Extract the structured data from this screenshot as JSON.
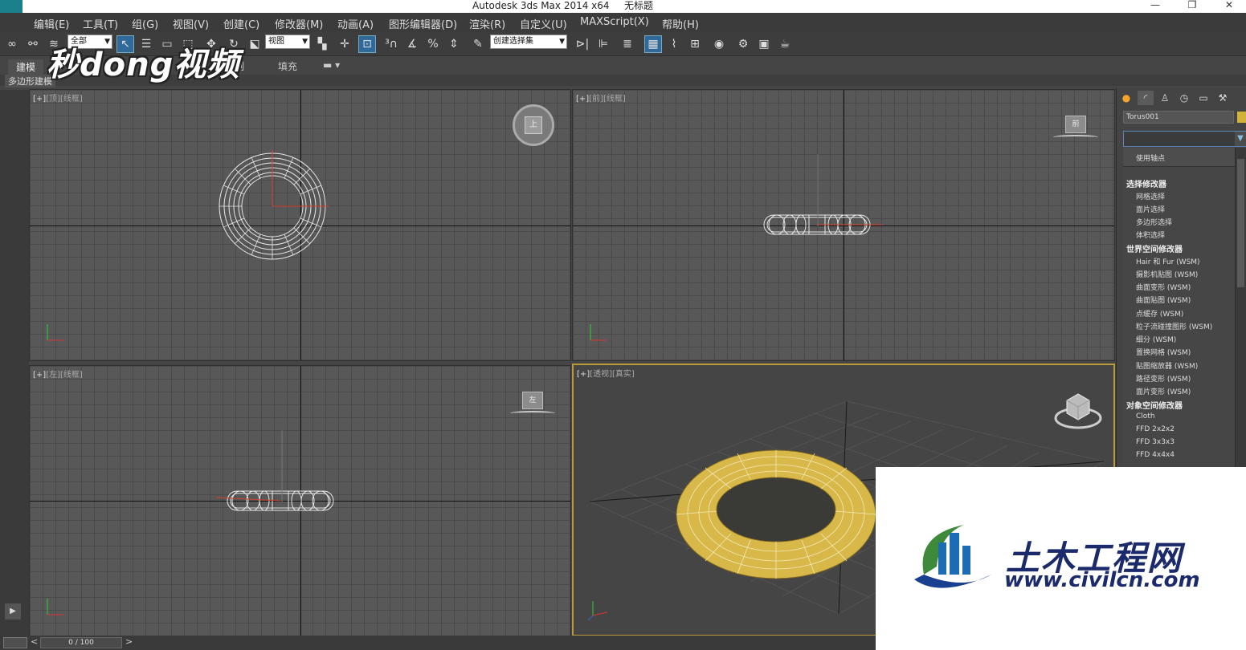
{
  "window": {
    "title": "Autodesk 3ds Max  2014 x64",
    "document": "无标题",
    "controls": [
      "—",
      "❐",
      "✕"
    ]
  },
  "menu": [
    "编辑(E)",
    "工具(T)",
    "组(G)",
    "视图(V)",
    "创建(C)",
    "修改器(M)",
    "动画(A)",
    "图形编辑器(D)",
    "渲染(R)",
    "自定义(U)",
    "MAXScript(X)",
    "帮助(H)"
  ],
  "toolbar": {
    "filter_value": "全部",
    "refcoord_value": "视图",
    "named_selection_value": "创建选择集"
  },
  "ribbon": {
    "tabs": [
      "建模",
      "绘制",
      "填充"
    ],
    "sub_label": "多边形建模"
  },
  "viewports": {
    "top": {
      "label_a": "[+]",
      "label_b": "[顶]",
      "label_c": "[线框]",
      "cube": "上"
    },
    "front": {
      "label_a": "[+]",
      "label_b": "[前]",
      "label_c": "[线框]",
      "cube": "前"
    },
    "left": {
      "label_a": "[+]",
      "label_b": "[左]",
      "label_c": "[线框]",
      "cube": "左"
    },
    "perspective": {
      "label_a": "[+]",
      "label_b": "[透视]",
      "label_c": "[真实]"
    }
  },
  "command_panel": {
    "object_name": "Torus001",
    "object_color": "#d2b33a",
    "modifier_dropdown": {
      "first_item": "使用轴点",
      "groups": [
        {
          "header": "选择修改器",
          "items": [
            "网格选择",
            "面片选择",
            "多边形选择",
            "体积选择"
          ]
        },
        {
          "header": "世界空间修改器",
          "items": [
            "Hair 和 Fur (WSM)",
            "摄影机贴图 (WSM)",
            "曲面变形 (WSM)",
            "曲面贴图 (WSM)",
            "点缓存 (WSM)",
            "粒子流碰撞图形 (WSM)",
            "细分 (WSM)",
            "置换网格 (WSM)",
            "贴图缩放器 (WSM)",
            "路径变形 (WSM)",
            "面片变形 (WSM)"
          ]
        },
        {
          "header": "对象空间修改器",
          "items": [
            "Cloth",
            "FFD 2x2x2",
            "FFD 3x3x3",
            "FFD 4x4x4"
          ]
        }
      ]
    }
  },
  "timeline": {
    "frame": "0 / 100"
  },
  "watermarks": {
    "top_left": "秒dong视频",
    "bottom_right_cn": "土木工程网",
    "bottom_right_en": "www.civilcn.com"
  },
  "colors": {
    "torus": "#d9b84a",
    "selection_border": "#b89a3a",
    "accent": "#2f6a9b"
  }
}
